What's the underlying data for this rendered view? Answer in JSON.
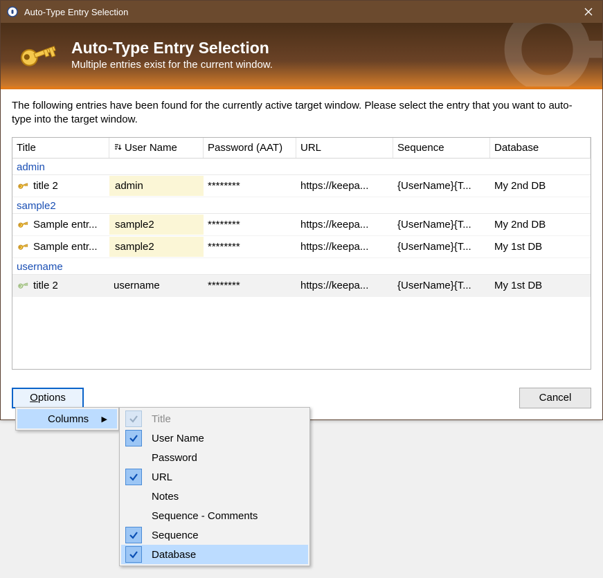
{
  "window": {
    "title": "Auto-Type Entry Selection"
  },
  "header": {
    "title": "Auto-Type Entry Selection",
    "subtitle": "Multiple entries exist for the current window."
  },
  "intro": "The following entries have been found for the currently active target window. Please select the entry that you want to auto-type into the target window.",
  "columns": {
    "title": "Title",
    "user": "User Name",
    "pass": "Password (AAT)",
    "url": "URL",
    "seq": "Sequence",
    "db": "Database"
  },
  "groups": [
    {
      "name": "admin",
      "rows": [
        {
          "title": "title 2",
          "user": "admin",
          "pass": "********",
          "url": "https://keepa...",
          "seq": "{UserName}{T...",
          "db": "My 2nd DB",
          "dim": false
        }
      ]
    },
    {
      "name": "sample2",
      "rows": [
        {
          "title": "Sample entr...",
          "user": "sample2",
          "pass": "********",
          "url": "https://keepa...",
          "seq": "{UserName}{T...",
          "db": "My 2nd DB",
          "dim": false
        },
        {
          "title": "Sample entr...",
          "user": "sample2",
          "pass": "********",
          "url": "https://keepa...",
          "seq": "{UserName}{T...",
          "db": "My 1st DB",
          "dim": false
        }
      ]
    },
    {
      "name": "username",
      "rows": [
        {
          "title": "title 2",
          "user": "username",
          "pass": "********",
          "url": "https://keepa...",
          "seq": "{UserName}{T...",
          "db": "My 1st DB",
          "dim": true
        }
      ]
    }
  ],
  "buttons": {
    "options": "Options",
    "cancel": "Cancel"
  },
  "options_menu": {
    "columns": "Columns"
  },
  "columns_menu": [
    {
      "label": "Title",
      "checked": true,
      "disabled": true
    },
    {
      "label": "User Name",
      "checked": true,
      "disabled": false
    },
    {
      "label": "Password",
      "checked": false,
      "disabled": false
    },
    {
      "label": "URL",
      "checked": true,
      "disabled": false
    },
    {
      "label": "Notes",
      "checked": false,
      "disabled": false
    },
    {
      "label": "Sequence - Comments",
      "checked": false,
      "disabled": false
    },
    {
      "label": "Sequence",
      "checked": true,
      "disabled": false
    },
    {
      "label": "Database",
      "checked": true,
      "disabled": false,
      "hover": true
    }
  ]
}
